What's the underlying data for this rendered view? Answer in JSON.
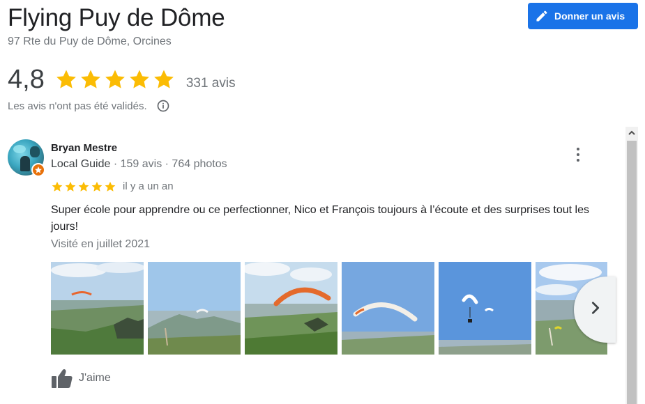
{
  "place": {
    "title": "Flying Puy de Dôme",
    "address": "97 Rte du Puy de Dôme, Orcines"
  },
  "actions": {
    "write_review_label": "Donner un avis"
  },
  "rating": {
    "score": "4,8",
    "stars": 5,
    "count_label": "331 avis",
    "validation_note": "Les avis n'ont pas été validés."
  },
  "review": {
    "author": "Bryan Mestre",
    "guide_label": "Local Guide",
    "meta": " · 159 avis · 764 photos",
    "stars": 5,
    "date": "il y a un an",
    "text": "Super école pour apprendre ou ce perfectionner, Nico et François toujours à l’écoute et des surprises tout les jours!",
    "visit": "Visité en juillet 2021",
    "like_label": "J'aime",
    "photo_count": 6
  },
  "colors": {
    "accent": "#1a73e8",
    "star": "#fbbc04",
    "badge": "#e8710a",
    "muted_text": "#70757a"
  },
  "icons": {
    "edit": "pencil-icon",
    "info": "info-icon",
    "more": "more-vert-icon",
    "next": "chevron-right-icon",
    "like": "thumb-up-icon",
    "scroll": "scroll-up-arrow-icon"
  }
}
